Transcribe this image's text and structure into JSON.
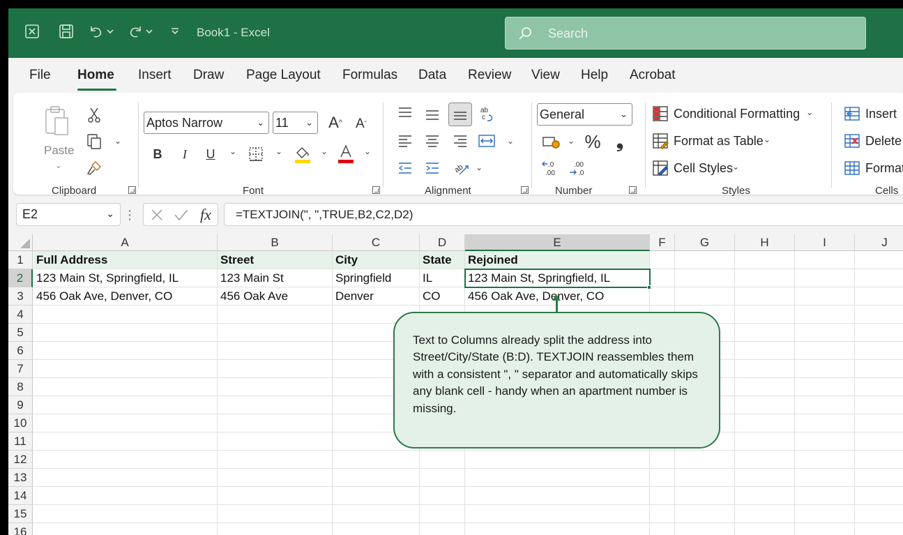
{
  "app": {
    "title": "Book1  -  Excel",
    "search_placeholder": "Search"
  },
  "menu": [
    "File",
    "Home",
    "Insert",
    "Draw",
    "Page Layout",
    "Formulas",
    "Data",
    "Review",
    "View",
    "Help",
    "Acrobat"
  ],
  "ribbon": {
    "clipboard": {
      "label": "Clipboard",
      "paste": "Paste"
    },
    "font": {
      "label": "Font",
      "family": "Aptos Narrow",
      "size": "11",
      "bold": "B",
      "italic": "I",
      "underline": "U"
    },
    "alignment": {
      "label": "Alignment"
    },
    "number": {
      "label": "Number",
      "format": "General"
    },
    "styles": {
      "label": "Styles",
      "conditional": "Conditional Formatting",
      "table": "Format as Table",
      "cell_styles": "Cell Styles"
    },
    "cells": {
      "label": "Cells",
      "insert": "Insert",
      "delete": "Delete",
      "format": "Format"
    }
  },
  "formula_bar": {
    "name_box": "E2",
    "formula": "=TEXTJOIN(\", \",TRUE,B2,C2,D2)"
  },
  "grid": {
    "columns": [
      "A",
      "B",
      "C",
      "D",
      "E",
      "F",
      "G",
      "H",
      "I",
      "J"
    ],
    "rows": [
      "1",
      "2",
      "3",
      "4",
      "5",
      "6",
      "7",
      "8",
      "9",
      "10",
      "11",
      "12",
      "13",
      "14",
      "15",
      "16"
    ],
    "headers": [
      "Full Address",
      "Street",
      "City",
      "State",
      "Rejoined"
    ],
    "data": [
      [
        "123 Main St, Springfield, IL",
        "123 Main St",
        "Springfield",
        "IL",
        "123 Main St, Springfield, IL"
      ],
      [
        "456 Oak Ave, Denver, CO",
        "456 Oak Ave",
        "Denver",
        "CO",
        "456 Oak Ave, Denver, CO"
      ]
    ],
    "selected_cell": "E2"
  },
  "callout": "Text to Columns already split the address into Street/City/State (B:D). TEXTJOIN reassembles them with a consistent \", \" separator and automatically skips any blank cell - handy when an apartment number is missing.",
  "colors": {
    "accent": "#1e7145",
    "callout_bg": "#e4f1e7",
    "header_fill": "#e6f2ea"
  }
}
